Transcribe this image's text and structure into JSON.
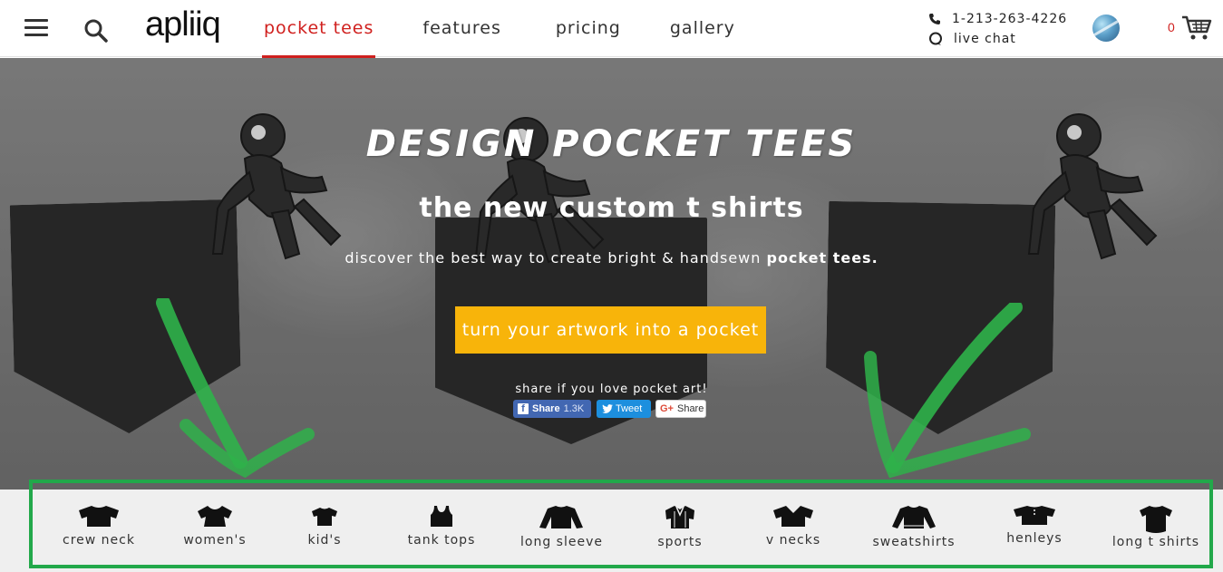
{
  "header": {
    "logo": "apliiq",
    "nav": [
      {
        "label": "pocket tees",
        "active": true
      },
      {
        "label": "features",
        "active": false
      },
      {
        "label": "pricing",
        "active": false
      },
      {
        "label": "gallery",
        "active": false
      }
    ],
    "phone": "1-213-263-4226",
    "live_chat": "live chat",
    "cart_count": "0"
  },
  "hero": {
    "title": "design pocket tees",
    "subtitle": "the new custom t shirts",
    "desc_prefix": "discover the best way to create bright & handsewn ",
    "desc_bold": "pocket tees.",
    "cta": "turn your artwork into a pocket",
    "share_prompt": "share if you love pocket art!",
    "social": {
      "facebook_label": "Share",
      "facebook_count": "1.3K",
      "twitter_label": "Tweet",
      "google_label": "Share"
    }
  },
  "categories": [
    {
      "label": "crew neck",
      "icon": "crew-neck-tee-icon"
    },
    {
      "label": "women's",
      "icon": "womens-tee-icon"
    },
    {
      "label": "kid's",
      "icon": "kids-tee-icon"
    },
    {
      "label": "tank tops",
      "icon": "tank-top-icon"
    },
    {
      "label": "long sleeve",
      "icon": "long-sleeve-icon"
    },
    {
      "label": "sports",
      "icon": "sports-jersey-icon"
    },
    {
      "label": "v necks",
      "icon": "v-neck-icon"
    },
    {
      "label": "sweatshirts",
      "icon": "sweatshirt-icon"
    },
    {
      "label": "henleys",
      "icon": "henley-icon"
    },
    {
      "label": "long t shirts",
      "icon": "long-t-shirt-icon"
    }
  ],
  "colors": {
    "accent_red": "#d0201e",
    "cta_yellow": "#f8b40a",
    "highlight_green": "#22a84a"
  }
}
